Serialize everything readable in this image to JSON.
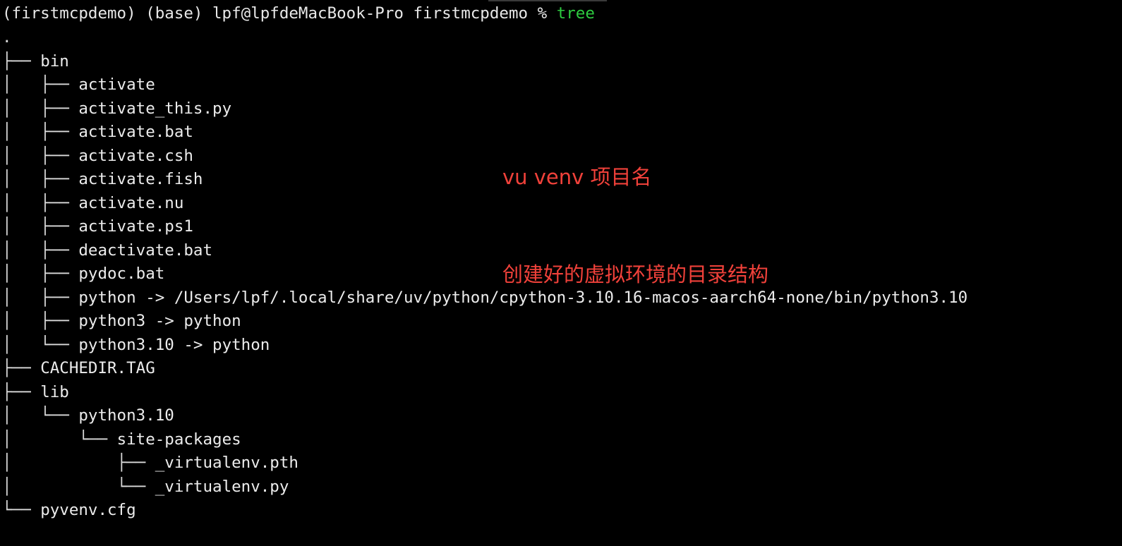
{
  "terminal": {
    "background": "#000000",
    "text_color": "#e8e8e8",
    "command_color": "#2ecc40",
    "prompt": {
      "env_label": "(firstmcpdemo) (base) lpf@lpfdeMacBook-Pro firstmcpdemo % ",
      "command": "tree"
    },
    "tree": [
      {
        "guide": ".",
        "name": ""
      },
      {
        "guide": "├── ",
        "name": "bin"
      },
      {
        "guide": "│   ├── ",
        "name": "activate"
      },
      {
        "guide": "│   ├── ",
        "name": "activate_this.py"
      },
      {
        "guide": "│   ├── ",
        "name": "activate.bat"
      },
      {
        "guide": "│   ├── ",
        "name": "activate.csh"
      },
      {
        "guide": "│   ├── ",
        "name": "activate.fish"
      },
      {
        "guide": "│   ├── ",
        "name": "activate.nu"
      },
      {
        "guide": "│   ├── ",
        "name": "activate.ps1"
      },
      {
        "guide": "│   ├── ",
        "name": "deactivate.bat"
      },
      {
        "guide": "│   ├── ",
        "name": "pydoc.bat"
      },
      {
        "guide": "│   ├── ",
        "name": "python -> /Users/lpf/.local/share/uv/python/cpython-3.10.16-macos-aarch64-none/bin/python3.10"
      },
      {
        "guide": "│   ├── ",
        "name": "python3 -> python"
      },
      {
        "guide": "│   └── ",
        "name": "python3.10 -> python"
      },
      {
        "guide": "├── ",
        "name": "CACHEDIR.TAG"
      },
      {
        "guide": "├── ",
        "name": "lib"
      },
      {
        "guide": "│   └── ",
        "name": "python3.10"
      },
      {
        "guide": "│       └── ",
        "name": "site-packages"
      },
      {
        "guide": "│           ├── ",
        "name": "_virtualenv.pth"
      },
      {
        "guide": "│           └── ",
        "name": "_virtualenv.py"
      },
      {
        "guide": "└── ",
        "name": "pyvenv.cfg"
      }
    ]
  },
  "annotation": {
    "color": "#f0413a",
    "line1": "vu venv 项目名",
    "line2": "创建好的虚拟环境的目录结构"
  }
}
